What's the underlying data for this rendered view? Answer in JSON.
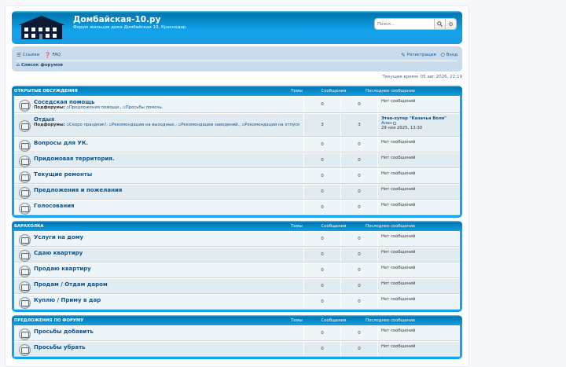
{
  "header": {
    "site_title": "Домбайская-10.ру",
    "site_description": "Форум жильцов дома Домбайская 10, Краснодар.",
    "logo_icon": "house-icon",
    "search_placeholder": "Поиск…"
  },
  "navbar": {
    "links_label": "Ссылки",
    "faq_label": "FAQ",
    "register_label": "Регистрация",
    "login_label": "Вход",
    "breadcrumb": "Список форумов"
  },
  "time": "Текущее время: 05 авг 2026, 22:19",
  "categories": [
    {
      "name": "Открытые обсуждения",
      "col_topics": "Темы",
      "col_posts": "Сообщения",
      "col_last": "Последнее сообщение",
      "forums": [
        {
          "title": "Соседская помощь",
          "subforums_label": "Подфорумы:",
          "subforums": [
            "Предложения помощи.",
            "Просьбы помочь."
          ],
          "topics": "0",
          "posts": "0",
          "last": "Нет сообщений"
        },
        {
          "title": "Отдых",
          "subforums_label": "Подфорумы:",
          "subforums": [
            "Скоро праздник!",
            "Рекомендации на выходные.",
            "Рекомендации заведений.",
            "Рекомендации на отпуск"
          ],
          "topics": "3",
          "posts": "3",
          "last_title": "Этно-хутор \"Казачья Воля\"",
          "last_user": "Алан",
          "last_date": "29 ноя 2025, 13:30"
        },
        {
          "title": "Вопросы для УК.",
          "topics": "0",
          "posts": "0",
          "last": "Нет сообщений"
        },
        {
          "title": "Придомовая территория.",
          "topics": "0",
          "posts": "0",
          "last": "Нет сообщений"
        },
        {
          "title": "Текущие ремонты",
          "topics": "0",
          "posts": "0",
          "last": "Нет сообщений"
        },
        {
          "title": "Предложения и пожелания",
          "topics": "0",
          "posts": "0",
          "last": "Нет сообщений"
        },
        {
          "title": "Голосования",
          "topics": "0",
          "posts": "0",
          "last": "Нет сообщений"
        }
      ]
    },
    {
      "name": "Барахолка",
      "col_topics": "Темы",
      "col_posts": "Сообщения",
      "col_last": "Последнее сообщение",
      "forums": [
        {
          "title": "Услуги на дому",
          "topics": "0",
          "posts": "0",
          "last": "Нет сообщений"
        },
        {
          "title": "Сдаю квартиру",
          "topics": "0",
          "posts": "0",
          "last": "Нет сообщений"
        },
        {
          "title": "Продаю квартиру",
          "topics": "0",
          "posts": "0",
          "last": "Нет сообщений"
        },
        {
          "title": "Продам / Отдам даром",
          "topics": "0",
          "posts": "0",
          "last": "Нет сообщений"
        },
        {
          "title": "Куплю / Приму в дар",
          "topics": "0",
          "posts": "0",
          "last": "Нет сообщений"
        }
      ]
    },
    {
      "name": "Предложения по форуму",
      "col_topics": "Темы",
      "col_posts": "Сообщения",
      "col_last": "Последнее сообщение",
      "forums": [
        {
          "title": "Просьбы добавить",
          "topics": "0",
          "posts": "0",
          "last": "Нет сообщений"
        },
        {
          "title": "Просьбы убрать",
          "topics": "0",
          "posts": "0",
          "last": "Нет сообщений"
        }
      ]
    }
  ]
}
